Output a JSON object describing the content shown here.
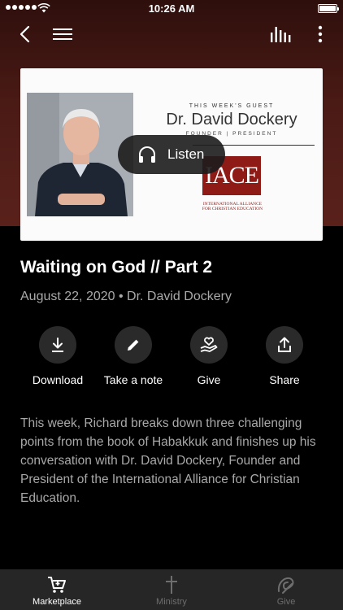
{
  "status_bar": {
    "time": "10:26 AM"
  },
  "guest_card": {
    "label": "THIS WEEK'S GUEST",
    "name": "Dr. David Dockery",
    "role": "FOUNDER | PRESIDENT",
    "logo": "IACE",
    "logo_text_line1": "INTERNATIONAL ALLIANCE",
    "logo_text_line2": "FOR CHRISTIAN EDUCATION"
  },
  "listen_button": {
    "label": "Listen",
    "icon": "headphones-icon"
  },
  "episode": {
    "title": "Waiting on God // Part 2",
    "meta": "August 22, 2020 • Dr. David Dockery",
    "description": "This week, Richard breaks down three challenging points from the book of Habakkuk and finishes up his conversation with Dr. David Dockery, Founder and President of the International Alliance for Christian Education."
  },
  "actions": [
    {
      "label": "Download",
      "icon": "download-icon"
    },
    {
      "label": "Take a note",
      "icon": "pencil-icon"
    },
    {
      "label": "Give",
      "icon": "heart-hand-icon"
    },
    {
      "label": "Share",
      "icon": "share-icon"
    }
  ],
  "tabs": [
    {
      "label": "Marketplace",
      "icon": "cart-icon",
      "active": true
    },
    {
      "label": "Ministry",
      "icon": "cross-icon",
      "active": false
    },
    {
      "label": "Give",
      "icon": "give-icon",
      "active": false
    }
  ],
  "colors": {
    "background": "#000000",
    "hero": "#4a1a15",
    "accent_logo": "#8f1b17",
    "tab_bar": "#262626"
  }
}
